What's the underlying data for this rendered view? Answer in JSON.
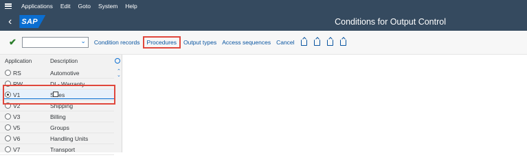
{
  "menubar": {
    "items": [
      {
        "label": "Applications"
      },
      {
        "label": "Edit"
      },
      {
        "label": "Goto"
      },
      {
        "label": "System"
      },
      {
        "label": "Help"
      }
    ]
  },
  "titlebar": {
    "logo": "SAP",
    "title": "Conditions for Output Control"
  },
  "toolbar": {
    "command_value": "",
    "buttons": [
      {
        "label": "Condition records"
      },
      {
        "label": "Procedures"
      },
      {
        "label": "Output types"
      },
      {
        "label": "Access sequences"
      },
      {
        "label": "Cancel"
      }
    ]
  },
  "table": {
    "headers": {
      "application": "Application",
      "description": "Description"
    },
    "rows": [
      {
        "app": "RS",
        "desc": "Automotive"
      },
      {
        "app": "RW",
        "desc": "DI - Warranty"
      },
      {
        "app": "V1",
        "desc": "Sales"
      },
      {
        "app": "V2",
        "desc": "Shipping"
      },
      {
        "app": "V3",
        "desc": "Billing"
      },
      {
        "app": "V5",
        "desc": "Groups"
      },
      {
        "app": "V6",
        "desc": "Handling Units"
      },
      {
        "app": "V7",
        "desc": "Transport"
      }
    ],
    "selected_index": 2
  }
}
